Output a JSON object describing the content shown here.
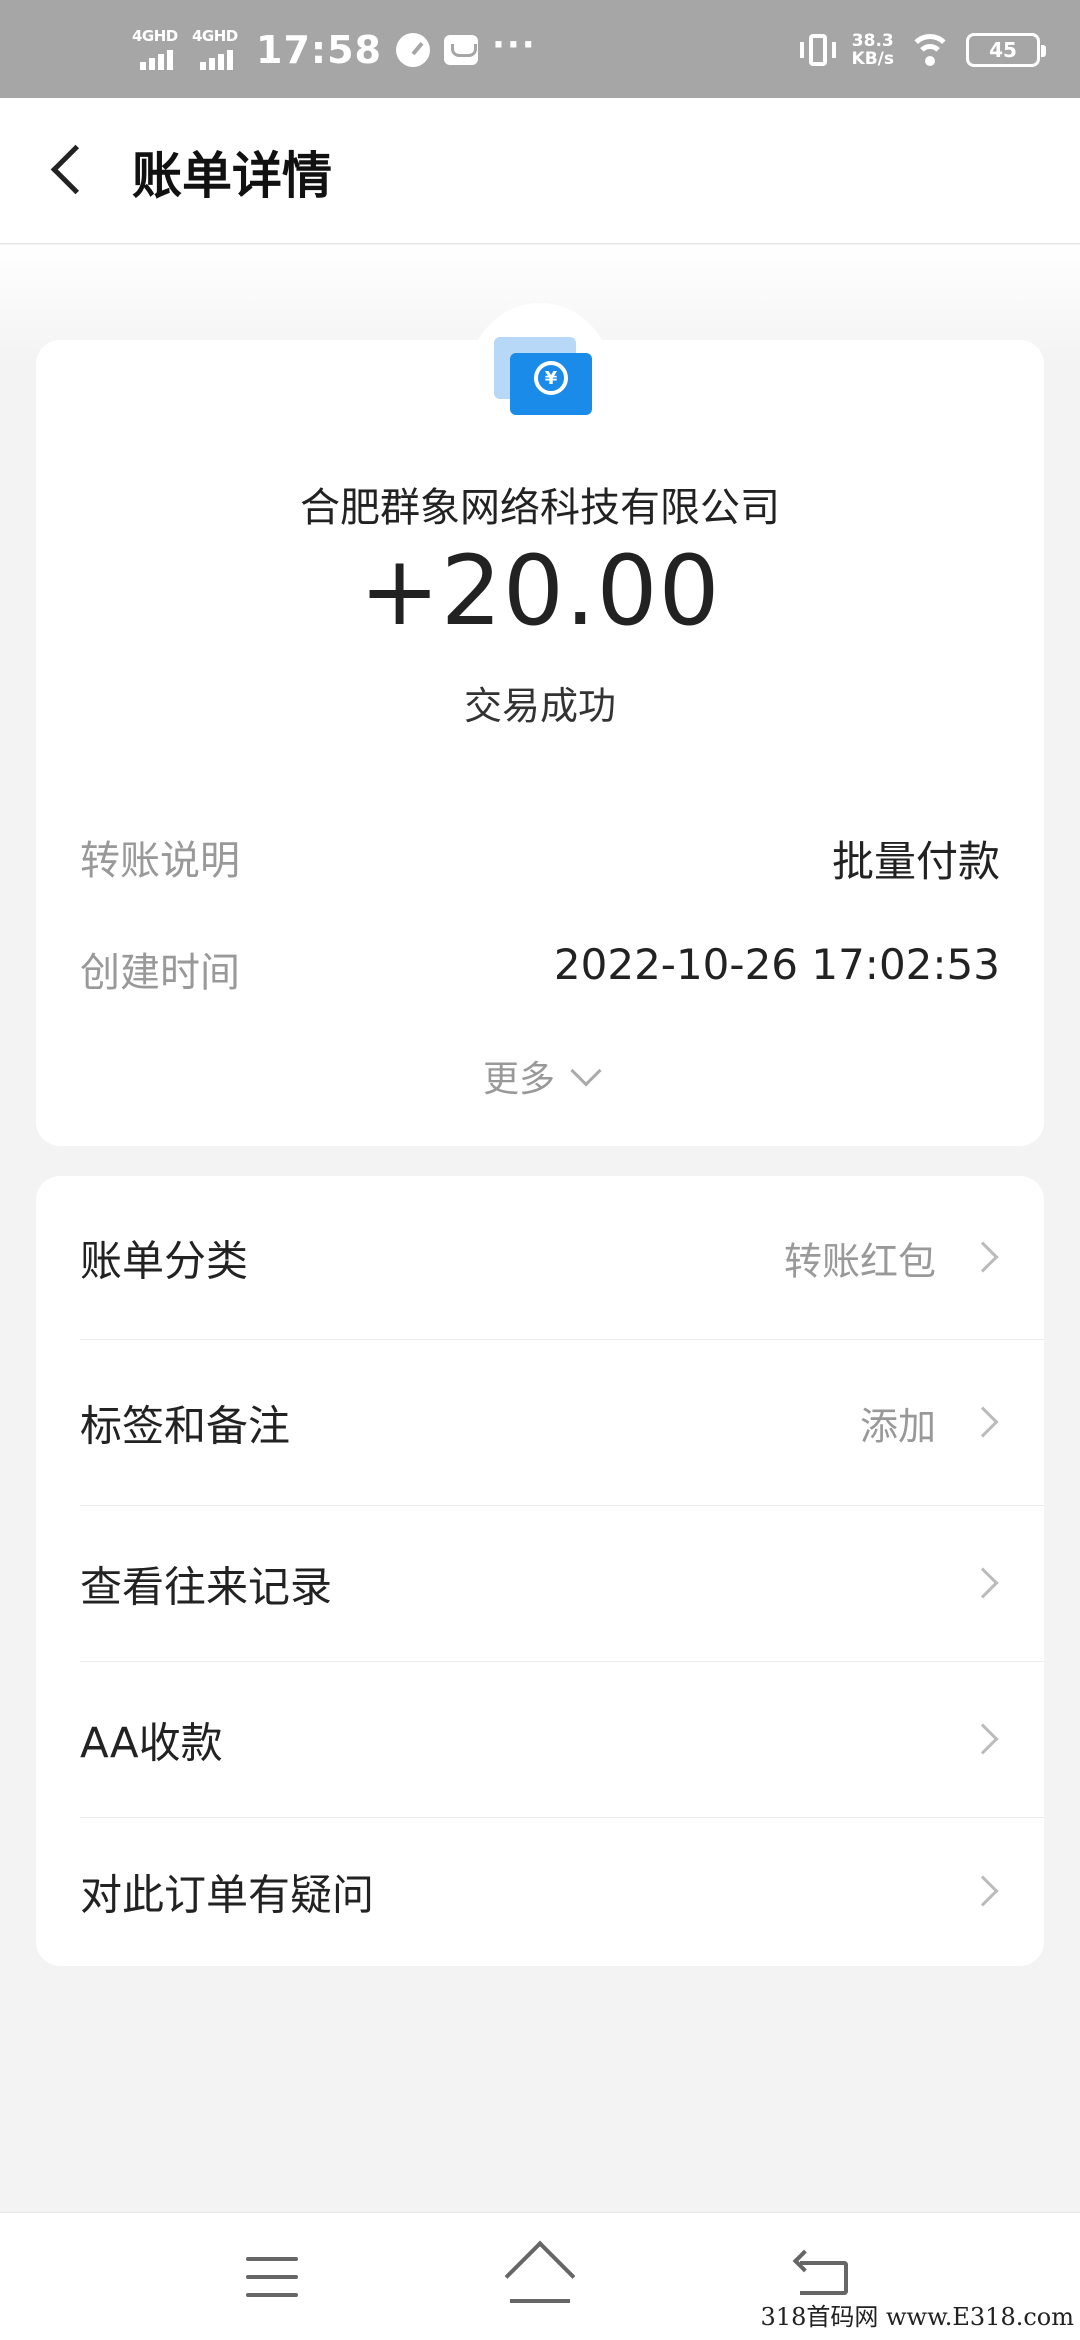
{
  "status_bar": {
    "network_1": "4GHD",
    "network_2": "4GHD",
    "time": "17:58",
    "more": "···",
    "speed_value": "38.3",
    "speed_unit": "KB/s",
    "battery": "45"
  },
  "header": {
    "title": "账单详情"
  },
  "summary": {
    "merchant": "合肥群象网络科技有限公司",
    "amount": "+20.00",
    "status": "交易成功",
    "logo_symbol": "¥",
    "rows": [
      {
        "key": "转账说明",
        "value": "批量付款"
      },
      {
        "key": "创建时间",
        "value": "2022-10-26 17:02:53"
      }
    ],
    "more_label": "更多"
  },
  "list": {
    "items": [
      {
        "label": "账单分类",
        "value": "转账红包"
      },
      {
        "label": "标签和备注",
        "value": "添加"
      },
      {
        "label": "查看往来记录",
        "value": ""
      },
      {
        "label": "AA收款",
        "value": ""
      },
      {
        "label": "对此订单有疑问",
        "value": ""
      }
    ]
  },
  "watermark": "318首码网 www.E318.com"
}
